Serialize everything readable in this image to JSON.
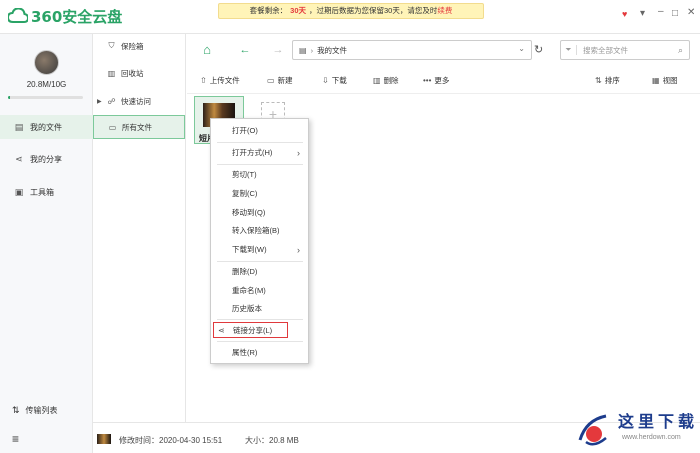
{
  "app": {
    "logo_text": "360安全云盘",
    "brand_color": "#2aa366"
  },
  "banner": {
    "prefix": "套餐剩余：",
    "days": "30天",
    "middle": "，过期后数据为您保留30天，请您及时",
    "renew": "续费"
  },
  "window_controls": [
    "shirt-icon",
    "gear-icon",
    "minimize-icon",
    "maximize-icon",
    "close-icon"
  ],
  "user": {
    "quota": "20.8M/10G",
    "quota_fraction": 0.002
  },
  "leftnav": {
    "items": [
      {
        "label": "我的文件",
        "icon": "file-icon"
      },
      {
        "label": "我的分享",
        "icon": "share-icon"
      },
      {
        "label": "工具箱",
        "icon": "toolbox-icon"
      }
    ],
    "transfer": "传输列表",
    "menu_icon": "hamburger-icon"
  },
  "subnav": {
    "items": [
      {
        "label": "保险箱",
        "icon": "shield-icon"
      },
      {
        "label": "回收站",
        "icon": "trash-icon"
      },
      {
        "label": "快速访问",
        "icon": "quick-access-icon"
      },
      {
        "label": "所有文件",
        "icon": "folder-icon"
      }
    ]
  },
  "navbar": {
    "path": "我的文件",
    "search_placeholder": "搜索全部文件"
  },
  "actions": {
    "upload": "上传文件",
    "new": "新建",
    "download": "下载",
    "delete": "删除",
    "more": "更多",
    "sort": "排序",
    "view": "视图"
  },
  "file": {
    "name": "短片"
  },
  "context_menu": {
    "items": [
      "打开(O)",
      "打开方式(H)",
      "剪切(T)",
      "复制(C)",
      "移动到(Q)",
      "转入保险箱(B)",
      "下载到(W)",
      "删除(D)",
      "重命名(M)",
      "历史版本",
      "链接分享(L)",
      "属性(R)"
    ]
  },
  "statusbar": {
    "modified": "修改时间：2020-04-30 15:51",
    "size": "大小：20.8 MB"
  },
  "watermark": {
    "text": "这里下载",
    "url": "www.herdown.com"
  }
}
